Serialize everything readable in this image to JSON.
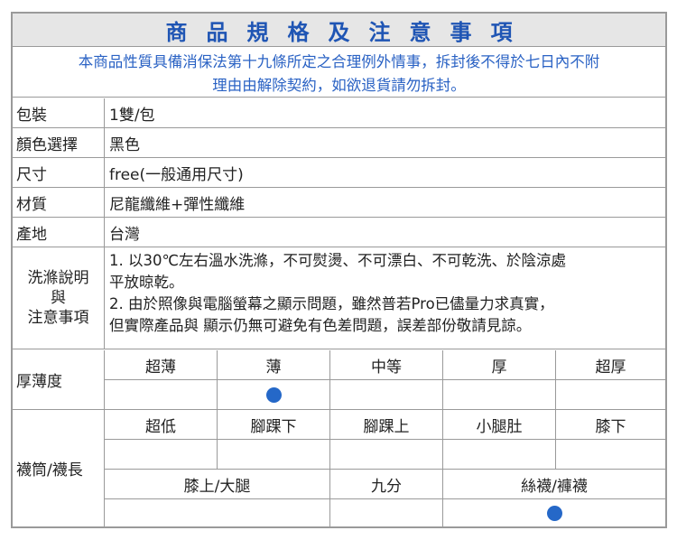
{
  "title": "商品規格及注意事項",
  "notice_line1": "本商品性質具備消保法第十九條所定之合理例外情事，拆封後不得於七日內不附",
  "notice_line2": "理由由解除契約，如欲退貨請勿拆封。",
  "specs": [
    {
      "label": "包裝",
      "value": "1雙/包"
    },
    {
      "label": "顏色選擇",
      "value": "黑色"
    },
    {
      "label": "尺寸",
      "value": "free(一般通用尺寸)"
    },
    {
      "label": "材質",
      "value": "尼龍纖維+彈性纖維"
    },
    {
      "label": "產地",
      "value": "台灣"
    }
  ],
  "care": {
    "label_line1": "洗滌說明",
    "label_line2": "與",
    "label_line3": "注意事項",
    "line1": "1. 以30℃左右溫水洗滌，不可熨燙、不可漂白、不可乾洗、於陰涼處",
    "line2": "平放晾乾。",
    "line3": "2. 由於照像與電腦螢幕之顯示問題，雖然普若Pro已儘量力求真實，",
    "line4": "但實際產品與 顯示仍無可避免有色差問題，誤差部份敬請見諒。"
  },
  "thickness": {
    "label": "厚薄度",
    "options": [
      "超薄",
      "薄",
      "中等",
      "厚",
      "超厚"
    ],
    "selected": "薄"
  },
  "length": {
    "label": "襪筒/襪長",
    "options_row1": [
      "超低",
      "腳踝下",
      "腳踝上",
      "小腿肚",
      "膝下"
    ],
    "options_row2": [
      "膝上/大腿",
      "九分",
      "絲襪/褲襪"
    ],
    "selected": "絲襪/褲襪"
  },
  "colors": {
    "title": "#1f55b4",
    "notice": "#2a62c4",
    "dot": "#2568c8",
    "border": "#9a9a9a"
  }
}
